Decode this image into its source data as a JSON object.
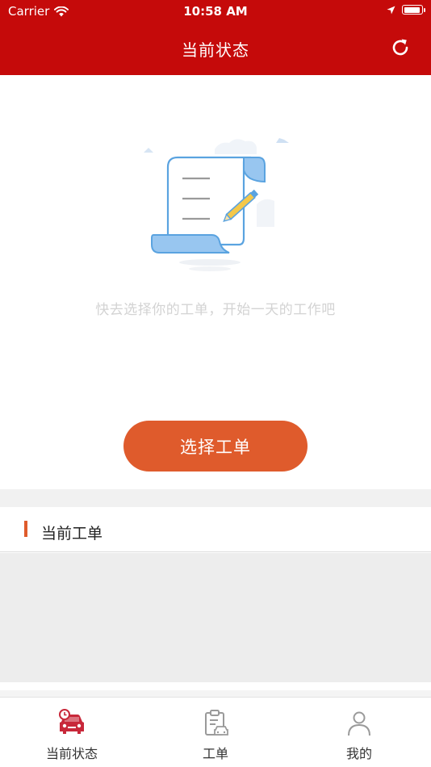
{
  "status_bar": {
    "carrier": "Carrier",
    "time": "10:58 AM"
  },
  "nav": {
    "title": "当前状态",
    "refresh_icon": "refresh-icon"
  },
  "empty_state": {
    "illustration_icon": "document-pencil-illustration",
    "message": "快去选择你的工单，开始一天的工作吧",
    "button_label": "选择工单"
  },
  "current_orders": {
    "title": "当前工单"
  },
  "tabbar": {
    "items": [
      {
        "label": "当前状态",
        "icon": "car-clock-icon",
        "active": true
      },
      {
        "label": "工单",
        "icon": "clipboard-car-icon",
        "active": false
      },
      {
        "label": "我的",
        "icon": "person-icon",
        "active": false
      }
    ]
  },
  "colors": {
    "nav_bg": "#c50a0a",
    "accent": "#df5b2c",
    "tab_active": "#c8283a",
    "tab_inactive": "#9a9a9a"
  }
}
